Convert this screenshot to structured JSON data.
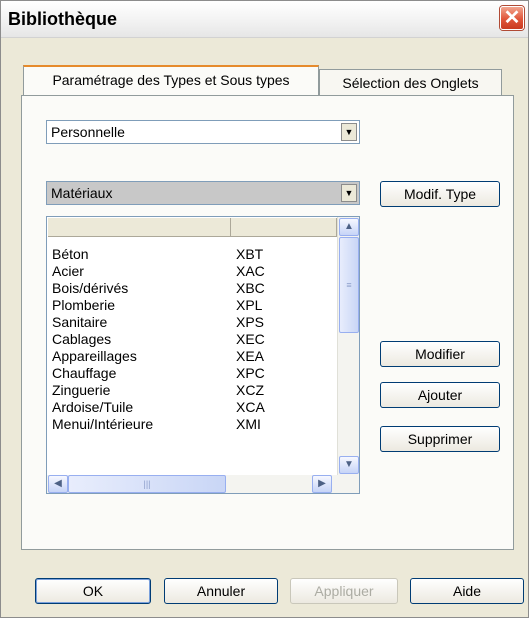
{
  "window": {
    "title": "Bibliothèque"
  },
  "tabs": [
    {
      "label": "Paramétrage des Types et Sous types",
      "active": true
    },
    {
      "label": "Sélection des Onglets",
      "active": false
    }
  ],
  "library_select": {
    "value": "Personnelle"
  },
  "category_select": {
    "value": "Matériaux"
  },
  "buttons": {
    "modif_type": "Modif. Type",
    "modifier": "Modifier",
    "ajouter": "Ajouter",
    "supprimer": "Supprimer"
  },
  "list": {
    "columns": [
      "",
      ""
    ],
    "rows": [
      {
        "name": "Béton",
        "code": "XBT"
      },
      {
        "name": "Acier",
        "code": "XAC"
      },
      {
        "name": "Bois/dérivés",
        "code": "XBC"
      },
      {
        "name": "Plomberie",
        "code": "XPL"
      },
      {
        "name": "Sanitaire",
        "code": "XPS"
      },
      {
        "name": "Cablages",
        "code": "XEC"
      },
      {
        "name": "Appareillages",
        "code": "XEA"
      },
      {
        "name": "Chauffage",
        "code": "XPC"
      },
      {
        "name": "Zinguerie",
        "code": "XCZ"
      },
      {
        "name": "Ardoise/Tuile",
        "code": "XCA"
      },
      {
        "name": "Menui/Intérieure",
        "code": "XMI"
      }
    ]
  },
  "footer": {
    "ok": "OK",
    "annuler": "Annuler",
    "appliquer": "Appliquer",
    "aide": "Aide"
  },
  "icons": {
    "close": "close-icon",
    "dropdown": "chevron-down-icon",
    "scroll_up": "arrow-up-icon",
    "scroll_down": "arrow-down-icon",
    "scroll_left": "arrow-left-icon",
    "scroll_right": "arrow-right-icon"
  }
}
